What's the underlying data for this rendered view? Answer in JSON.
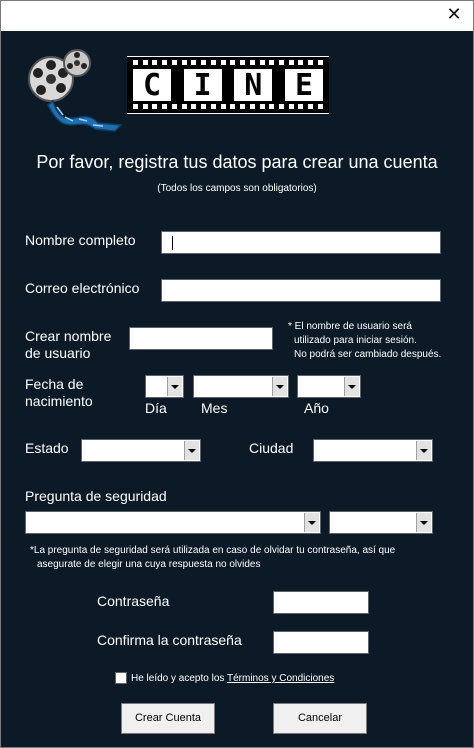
{
  "window": {
    "close_glyph": "✕"
  },
  "logo": {
    "letters": [
      "C",
      "I",
      "N",
      "E"
    ],
    "reel_icon": "film-reel-icon"
  },
  "heading": "Por favor, registra tus datos para crear una cuenta",
  "subheading": "(Todos los campos son obligatorios)",
  "fields": {
    "full_name_label": "Nombre completo",
    "email_label": "Correo electrónico",
    "username_label_line1": "Crear nombre",
    "username_label_line2": "de usuario",
    "username_note_line1": "* El nombre de usuario será",
    "username_note_line2": "utilizado para iniciar sesión.",
    "username_note_line3": "No podrá ser cambiado después.",
    "birth_label_line1": "Fecha de",
    "birth_label_line2": "nacimiento",
    "day_label": "Día",
    "month_label": "Mes",
    "year_label": "Año",
    "state_label": "Estado",
    "city_label": "Ciudad",
    "security_question_label": "Pregunta de seguridad",
    "security_note_line1": "*La pregunta de seguridad será utilizada en caso de olvidar tu contraseña, así que",
    "security_note_line2": "asegurate de elegir una cuya respuesta no olvides",
    "password_label": "Contraseña",
    "confirm_password_label": "Confirma la contraseña",
    "terms_prefix": "He leído y acepto los",
    "terms_link": "Términos y Condiciones"
  },
  "buttons": {
    "create": "Crear Cuenta",
    "cancel": "Cancelar"
  },
  "colors": {
    "background": "#0b1a26",
    "text": "#ffffff"
  }
}
